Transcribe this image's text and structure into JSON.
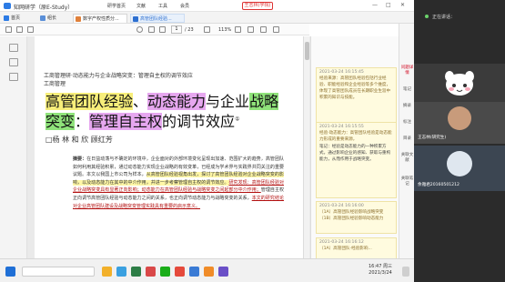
{
  "app": {
    "title": "知网研学（原E-Study）",
    "menus": [
      "研学首页",
      "文献",
      "工具",
      "会员"
    ],
    "user": "王志林(学院)",
    "window_buttons": [
      "—",
      "□",
      "✕"
    ]
  },
  "tabs": [
    {
      "label": "首页"
    },
    {
      "label": "组长"
    },
    {
      "label": "数字产权性质分..."
    },
    {
      "label": "高管团队经验..."
    }
  ],
  "toolbar": {
    "page_current": "1",
    "page_total": "/ 23",
    "zoom": "113%"
  },
  "paper": {
    "header_line1": "工商管理研·动态能力与企业战略突变：管理自主权的调节效应",
    "header_line2": "工商管理",
    "title_seg1": "高管团队经验",
    "title_seg2": "、",
    "title_seg3": "动态能力",
    "title_seg4": "与企业",
    "title_seg5": "战略",
    "title_seg6": "突变",
    "title_seg7": "：",
    "title_seg8": "管理自主权",
    "title_seg9": "的调节效应",
    "title_mark": "①",
    "authors": "□杨  林  和  欣  顾红芳",
    "abstract_prefix": "摘要：",
    "abstract_1": "在日益动荡与不确定的环境中，企业面对的外部环境变化呈现出加速、范围扩大的趋势，高管团队如何利用其经验积累，通过动态能力实现企业战略的有效变革，已经成为学术界与实践界共同关注的重要议题。本文以我国上市公司为样本，",
    "abstract_hl": "从高管团队经验视角出发，探讨了高管团队经验对企业战略突变的影响，以及动态能力在其中的中介作用，并进一步考察管理自主权的调节效应。",
    "abstract_ul1": "研究发现：高管团队经验对企业战略突变具有显著正向影响；动态能力在高管团队经验与战略突变之间起部分中介作用；",
    "abstract_2": "管理自主权正向调节高管团队经验与动态能力之间的关系，也正向调节动态能力与战略突变的关系，",
    "abstract_ul2": "本文的研究结论对企业高管团队建设及战略突变管理实践具有重要的启示意义。"
  },
  "notes": [
    {
      "time": "2021-03-24  16:15:45",
      "text": "经验来源：高管团队经验包括行业经验、职能经验和企业经验等多个维度，体现了高管团队成员在长期职业生涯中积累的知识与技能。",
      "label": "",
      "value": ""
    },
    {
      "time": "2021-03-24  16:15:55",
      "text": "经验·动态能力：高管团队经验是动态能力形成的重要来源，",
      "label": "笔记：",
      "value": "经验是动态能力的一种积累方式，通过影响企业的感知、获取与重构能力，从而作用于战略突变。"
    },
    {
      "time": "2021-03-24  16:16:00",
      "text": "（1A）高管团队经验影响战略突变（1B）高管团队经验影响动态能力",
      "label": "",
      "value": ""
    },
    {
      "time": "2021-03-24  16:16:12",
      "text": "（1A）高管团队·经验影响...",
      "label": "",
      "value": ""
    }
  ],
  "rightrail": [
    "问题详情",
    "笔记",
    "摘录",
    "标注",
    "目录",
    "关联文献",
    "关联笔记"
  ],
  "meeting": {
    "speaking": "正在讲话：",
    "tile1_label": "",
    "tile2_label": "王志林(研究生)",
    "tile3_label": "余雅君20160501212"
  },
  "taskbar": {
    "time": "16:47 周三",
    "date": "2021/3/24"
  }
}
